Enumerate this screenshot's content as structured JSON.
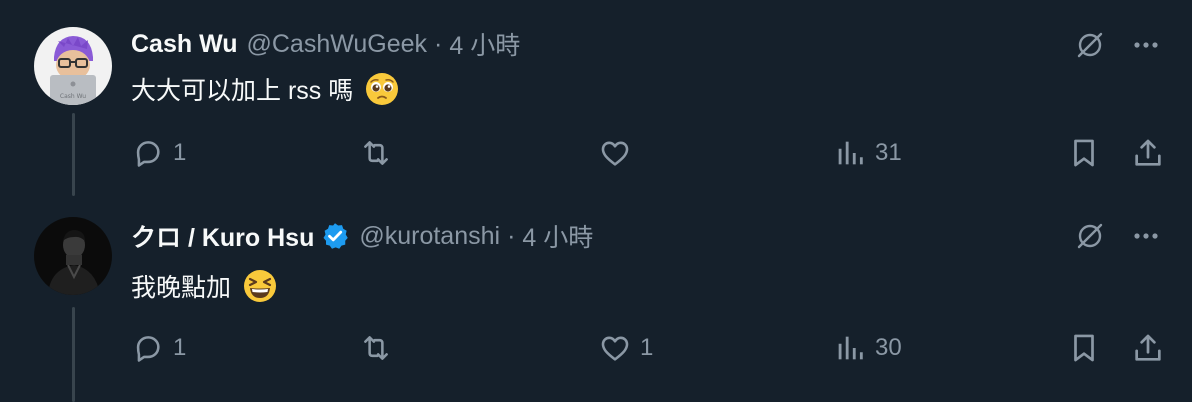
{
  "colors": {
    "background": "#15202b",
    "text": "#f7f9f9",
    "secondary": "#8b98a5",
    "thread_line": "#38444d",
    "verified": "#1d9bf0"
  },
  "tweets": [
    {
      "display_name": "Cash Wu",
      "handle": "@CashWuGeek",
      "separator": "·",
      "time": "4 小時",
      "text": "大大可以加上 rss 嗎",
      "emoji": "pleading-face",
      "verified": false,
      "stats": {
        "replies": "1",
        "retweets": "",
        "likes": "",
        "views": "31"
      }
    },
    {
      "display_name": "クロ / Kuro Hsu",
      "handle": "@kurotanshi",
      "separator": "·",
      "time": "4 小時",
      "text": "我晚點加",
      "emoji": "grinning-squinting-face",
      "verified": true,
      "stats": {
        "replies": "1",
        "retweets": "",
        "likes": "1",
        "views": "30"
      }
    }
  ]
}
